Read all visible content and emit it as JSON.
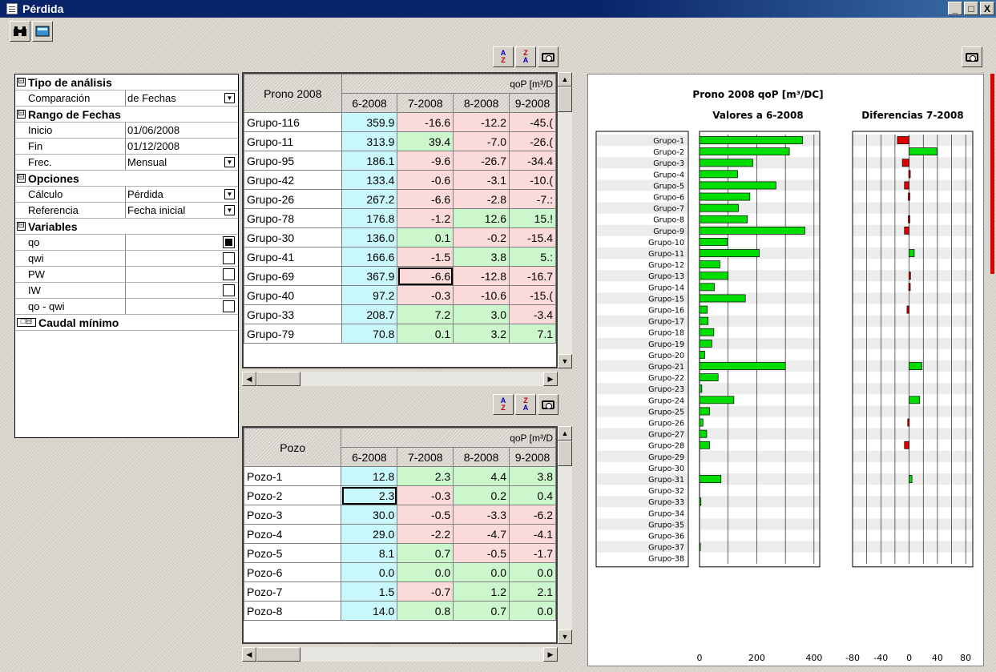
{
  "window": {
    "title": "Pérdida",
    "controls": [
      "_",
      "□",
      "X"
    ]
  },
  "props": {
    "sections": [
      {
        "title": "Tipo de análisis",
        "toggle": "⊟",
        "rows": [
          {
            "key": "Comparación",
            "value": "de Fechas",
            "kind": "dropdown"
          }
        ]
      },
      {
        "title": "Rango de Fechas",
        "toggle": "⊟",
        "rows": [
          {
            "key": "Inicio",
            "value": "01/06/2008"
          },
          {
            "key": "Fin",
            "value": "01/12/2008"
          },
          {
            "key": "Frec.",
            "value": "Mensual",
            "kind": "dropdown"
          }
        ]
      },
      {
        "title": "Opciones",
        "toggle": "⊟",
        "rows": [
          {
            "key": "Cálculo",
            "value": "Pérdida",
            "kind": "dropdown"
          },
          {
            "key": "Referencia",
            "value": "Fecha inicial",
            "kind": "dropdown"
          }
        ]
      },
      {
        "title": "Variables",
        "toggle": "⊟",
        "rows": [
          {
            "key": "qo",
            "value": "",
            "kind": "check",
            "checked": true
          },
          {
            "key": "qwi",
            "value": "",
            "kind": "check",
            "checked": false
          },
          {
            "key": "PW",
            "value": "",
            "kind": "check",
            "checked": false
          },
          {
            "key": "IW",
            "value": "",
            "kind": "check",
            "checked": false
          },
          {
            "key": "qo - qwi",
            "value": "",
            "kind": "check",
            "checked": false
          }
        ]
      },
      {
        "title": "Caudal mínimo",
        "toggle": "□⊟",
        "rows": []
      }
    ]
  },
  "grid1": {
    "corner": "Prono 2008",
    "unit": "qoP [m³/D",
    "cols": [
      "6-2008",
      "7-2008",
      "8-2008",
      "9-2008"
    ],
    "rows": [
      {
        "label": "Grupo-116",
        "v": [
          "359.9",
          "-16.6",
          "-12.2",
          "-45.("
        ],
        "c": [
          "bl",
          "rd",
          "rd",
          "rd"
        ]
      },
      {
        "label": "Grupo-11",
        "v": [
          "313.9",
          "39.4",
          "-7.0",
          "-26.("
        ],
        "c": [
          "bl",
          "gr",
          "rd",
          "rd"
        ]
      },
      {
        "label": "Grupo-95",
        "v": [
          "186.1",
          "-9.6",
          "-26.7",
          "-34.4"
        ],
        "c": [
          "bl",
          "rd",
          "rd",
          "rd"
        ]
      },
      {
        "label": "Grupo-42",
        "v": [
          "133.4",
          "-0.6",
          "-3.1",
          "-10.("
        ],
        "c": [
          "bl",
          "rd",
          "rd",
          "rd"
        ]
      },
      {
        "label": "Grupo-26",
        "v": [
          "267.2",
          "-6.6",
          "-2.8",
          "-7.:"
        ],
        "c": [
          "bl",
          "rd",
          "rd",
          "rd"
        ]
      },
      {
        "label": "Grupo-78",
        "v": [
          "176.8",
          "-1.2",
          "12.6",
          "15.!"
        ],
        "c": [
          "bl",
          "rd",
          "gr",
          "gr"
        ]
      },
      {
        "label": "Grupo-30",
        "v": [
          "136.0",
          "0.1",
          "-0.2",
          "-15.4"
        ],
        "c": [
          "bl",
          "gr",
          "rd",
          "rd"
        ]
      },
      {
        "label": "Grupo-41",
        "v": [
          "166.6",
          "-1.5",
          "3.8",
          "5.:"
        ],
        "c": [
          "bl",
          "rd",
          "gr",
          "gr"
        ]
      },
      {
        "label": "Grupo-69",
        "v": [
          "367.9",
          "-6.6",
          "-12.8",
          "-16.7"
        ],
        "c": [
          "bl",
          "rd",
          "rd",
          "rd"
        ],
        "sel": 1
      },
      {
        "label": "Grupo-40",
        "v": [
          "97.2",
          "-0.3",
          "-10.6",
          "-15.("
        ],
        "c": [
          "bl",
          "rd",
          "rd",
          "rd"
        ]
      },
      {
        "label": "Grupo-33",
        "v": [
          "208.7",
          "7.2",
          "3.0",
          "-3.4"
        ],
        "c": [
          "bl",
          "gr",
          "gr",
          "rd"
        ]
      },
      {
        "label": "Grupo-79",
        "v": [
          "70.8",
          "0.1",
          "3.2",
          "7.1"
        ],
        "c": [
          "bl",
          "gr",
          "gr",
          "gr"
        ]
      }
    ]
  },
  "grid2": {
    "corner": "Pozo",
    "unit": "qoP [m³/D",
    "cols": [
      "6-2008",
      "7-2008",
      "8-2008",
      "9-2008"
    ],
    "rows": [
      {
        "label": "Pozo-1",
        "v": [
          "12.8",
          "2.3",
          "4.4",
          "3.8"
        ],
        "c": [
          "bl",
          "gr",
          "gr",
          "gr"
        ]
      },
      {
        "label": "Pozo-2",
        "v": [
          "2.3",
          "-0.3",
          "0.2",
          "0.4"
        ],
        "c": [
          "bl",
          "rd",
          "gr",
          "gr"
        ],
        "sel": 0
      },
      {
        "label": "Pozo-3",
        "v": [
          "30.0",
          "-0.5",
          "-3.3",
          "-6.2"
        ],
        "c": [
          "bl",
          "rd",
          "rd",
          "rd"
        ]
      },
      {
        "label": "Pozo-4",
        "v": [
          "29.0",
          "-2.2",
          "-4.7",
          "-4.1"
        ],
        "c": [
          "bl",
          "rd",
          "rd",
          "rd"
        ]
      },
      {
        "label": "Pozo-5",
        "v": [
          "8.1",
          "0.7",
          "-0.5",
          "-1.7"
        ],
        "c": [
          "bl",
          "gr",
          "rd",
          "rd"
        ]
      },
      {
        "label": "Pozo-6",
        "v": [
          "0.0",
          "0.0",
          "0.0",
          "0.0"
        ],
        "c": [
          "bl",
          "gr",
          "gr",
          "gr"
        ]
      },
      {
        "label": "Pozo-7",
        "v": [
          "1.5",
          "-0.7",
          "1.2",
          "2.1"
        ],
        "c": [
          "bl",
          "rd",
          "gr",
          "gr"
        ]
      },
      {
        "label": "Pozo-8",
        "v": [
          "14.0",
          "0.8",
          "0.7",
          "0.0"
        ],
        "c": [
          "bl",
          "gr",
          "gr",
          "gr"
        ]
      }
    ]
  },
  "chart_data": {
    "type": "bar",
    "title": "Prono 2008  qoP [m³/DC]",
    "categories": [
      "Grupo-1",
      "Grupo-2",
      "Grupo-3",
      "Grupo-4",
      "Grupo-5",
      "Grupo-6",
      "Grupo-7",
      "Grupo-8",
      "Grupo-9",
      "Grupo-10",
      "Grupo-11",
      "Grupo-12",
      "Grupo-13",
      "Grupo-14",
      "Grupo-15",
      "Grupo-16",
      "Grupo-17",
      "Grupo-18",
      "Grupo-19",
      "Grupo-20",
      "Grupo-21",
      "Grupo-22",
      "Grupo-23",
      "Grupo-24",
      "Grupo-25",
      "Grupo-26",
      "Grupo-27",
      "Grupo-28",
      "Grupo-29",
      "Grupo-30",
      "Grupo-31",
      "Grupo-32",
      "Grupo-33",
      "Grupo-34",
      "Grupo-35",
      "Grupo-36",
      "Grupo-37",
      "Grupo-38"
    ],
    "panels": [
      {
        "subtitle": "Valores a 6-2008",
        "xlim": [
          0,
          420
        ],
        "ticks": [
          0,
          200,
          400
        ],
        "values": [
          360,
          314,
          186,
          133,
          267,
          176,
          136,
          167,
          368,
          97,
          209,
          71,
          100,
          52,
          160,
          27,
          30,
          50,
          43,
          18,
          300,
          65,
          8,
          120,
          35,
          12,
          25,
          35,
          0,
          0,
          75,
          0,
          5,
          0,
          0,
          0,
          3,
          0
        ],
        "color": "#00dd00"
      },
      {
        "subtitle": "Diferencias  7-2008",
        "xlim": [
          -80,
          90
        ],
        "ticks": [
          -80,
          -40,
          0,
          40,
          80
        ],
        "values": [
          -16.6,
          39.4,
          -9.6,
          -0.6,
          -6.6,
          -1.2,
          0,
          -1.2,
          -6.6,
          0,
          7.2,
          0,
          -0.3,
          -0.6,
          0,
          -3,
          0,
          0,
          0,
          0,
          18,
          0,
          0,
          15,
          0,
          -2,
          0,
          -6.6,
          0,
          0,
          4,
          0,
          0,
          0,
          0,
          0,
          0,
          0
        ],
        "pos_color": "#00dd00",
        "neg_color": "#e00000"
      }
    ],
    "grid": true
  }
}
